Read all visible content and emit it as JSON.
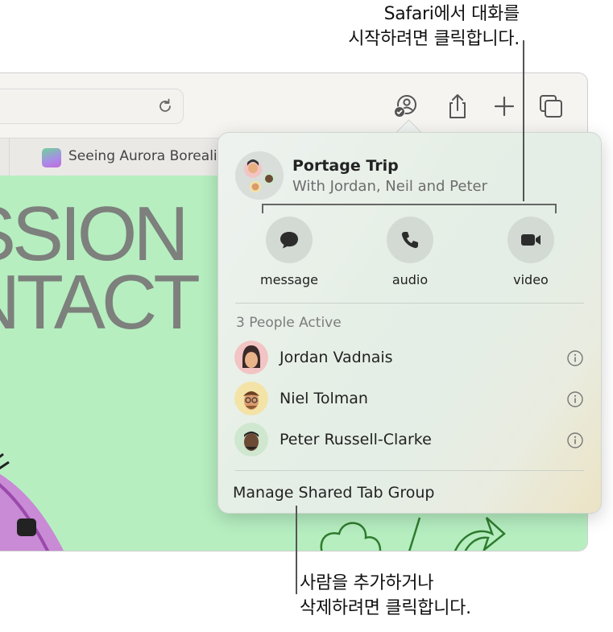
{
  "callouts": {
    "top_line1": "Safari에서 대화를",
    "top_line2": "시작하려면 클릭합니다.",
    "bottom_line1": "사람을 추가하거나",
    "bottom_line2": "삭제하려면 클릭합니다."
  },
  "browser": {
    "tab_title": "Seeing Aurora Borealis",
    "headline_line1": "SSION",
    "headline_line2": "NTACT",
    "toolbar_icons": [
      "share-collab-icon",
      "share-icon",
      "new-tab-icon",
      "tab-overview-icon"
    ]
  },
  "popover": {
    "group_title": "Portage Trip",
    "group_subtitle": "With Jordan, Neil and Peter",
    "actions": [
      {
        "label": "message",
        "icon": "message-icon"
      },
      {
        "label": "audio",
        "icon": "phone-icon"
      },
      {
        "label": "video",
        "icon": "video-icon"
      }
    ],
    "people_header": "3 People Active",
    "people": [
      {
        "name": "Jordan Vadnais",
        "avatar_color": "#f2c4c4"
      },
      {
        "name": "Niel Tolman",
        "avatar_color": "#f3e3a6"
      },
      {
        "name": "Peter Russell-Clarke",
        "avatar_color": "#cfe6cf"
      }
    ],
    "manage_label": "Manage Shared Tab Group"
  }
}
